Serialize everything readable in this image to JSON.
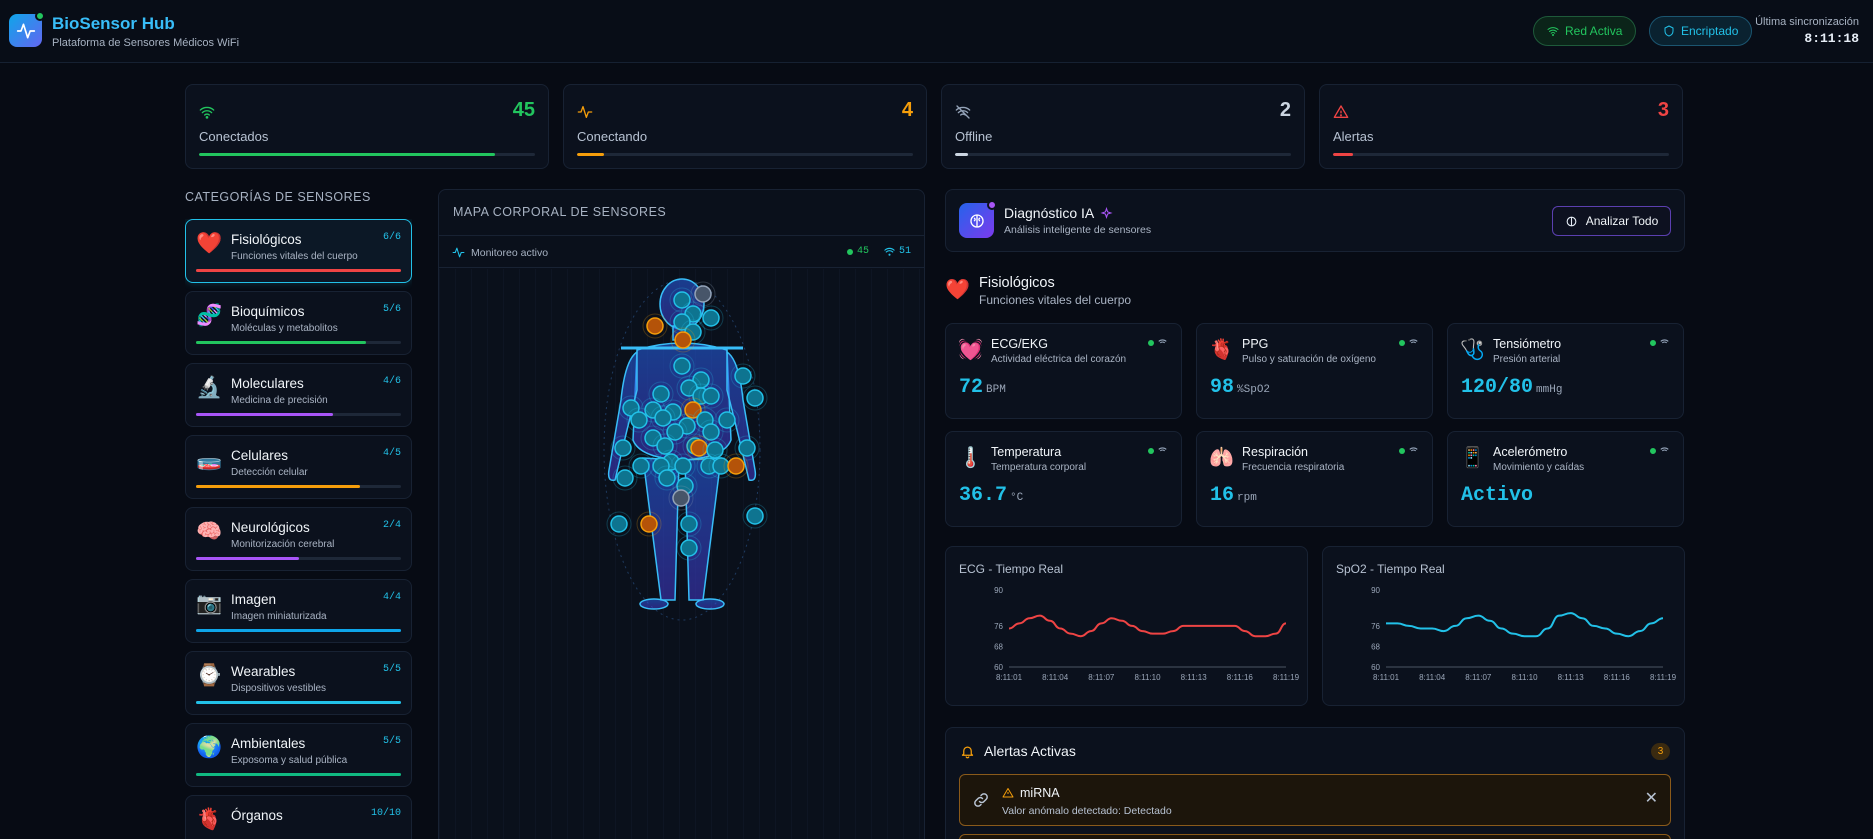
{
  "header": {
    "title": "BioSensor Hub",
    "subtitle": "Plataforma de Sensores Médicos WiFi",
    "network_label": "Red Activa",
    "encrypted_label": "Encriptado",
    "sync_label": "Última sincronización",
    "sync_time": "8:11:18"
  },
  "stats": [
    {
      "label": "Conectados",
      "value": "45",
      "color": "#22c55e",
      "progress": 0.88
    },
    {
      "label": "Conectando",
      "value": "4",
      "color": "#f59e0b",
      "progress": 0.08
    },
    {
      "label": "Offline",
      "value": "2",
      "color": "#cbd5e1",
      "progress": 0.04
    },
    {
      "label": "Alertas",
      "value": "3",
      "color": "#ef4444",
      "progress": 0.06
    }
  ],
  "categories": {
    "heading": "CATEGORÍAS DE SENSORES",
    "items": [
      {
        "emoji": "❤️",
        "name": "Fisiológicos",
        "desc": "Funciones vitales del cuerpo",
        "count": "6/6",
        "color": "#ef4444",
        "progress": 1.0
      },
      {
        "emoji": "🧬",
        "name": "Bioquímicos",
        "desc": "Moléculas y metabolitos",
        "count": "5/6",
        "color": "#22c55e",
        "progress": 0.83
      },
      {
        "emoji": "🔬",
        "name": "Moleculares",
        "desc": "Medicina de precisión",
        "count": "4/6",
        "color": "#a855f7",
        "progress": 0.67
      },
      {
        "emoji": "🧫",
        "name": "Celulares",
        "desc": "Detección celular",
        "count": "4/5",
        "color": "#f59e0b",
        "progress": 0.8
      },
      {
        "emoji": "🧠",
        "name": "Neurológicos",
        "desc": "Monitorización cerebral",
        "count": "2/4",
        "color": "#a855f7",
        "progress": 0.5
      },
      {
        "emoji": "📷",
        "name": "Imagen",
        "desc": "Imagen miniaturizada",
        "count": "4/4",
        "color": "#0ea5e9",
        "progress": 1.0
      },
      {
        "emoji": "⌚",
        "name": "Wearables",
        "desc": "Dispositivos vestibles",
        "count": "5/5",
        "color": "#22c1e8",
        "progress": 1.0
      },
      {
        "emoji": "🌍",
        "name": "Ambientales",
        "desc": "Exposoma y salud pública",
        "count": "5/5",
        "color": "#10b981",
        "progress": 1.0
      },
      {
        "emoji": "🫀",
        "name": "Órganos",
        "desc": "",
        "count": "10/10",
        "color": "#22c1e8",
        "progress": 1.0
      }
    ]
  },
  "map": {
    "title": "MAPA CORPORAL DE SENSORES",
    "status": "Monitoreo activo",
    "active_count": "45",
    "wifi_count": "51"
  },
  "ai": {
    "title": "Diagnóstico IA",
    "subtitle": "Análisis inteligente de sensores",
    "button": "Analizar Todo"
  },
  "section": {
    "emoji": "❤️",
    "title": "Fisiológicos",
    "subtitle": "Funciones vitales del cuerpo"
  },
  "sensors": [
    {
      "emoji": "💓",
      "name": "ECG/EKG",
      "desc": "Actividad eléctrica del corazón",
      "value": "72",
      "unit": "BPM"
    },
    {
      "emoji": "🫀",
      "name": "PPG",
      "desc": "Pulso y saturación de oxígeno",
      "value": "98",
      "unit": "%SpO2"
    },
    {
      "emoji": "🩺",
      "name": "Tensiómetro",
      "desc": "Presión arterial",
      "value": "120/80",
      "unit": "mmHg"
    },
    {
      "emoji": "🌡️",
      "name": "Temperatura",
      "desc": "Temperatura corporal",
      "value": "36.7",
      "unit": "°C"
    },
    {
      "emoji": "🫁",
      "name": "Respiración",
      "desc": "Frecuencia respiratoria",
      "value": "16",
      "unit": "rpm"
    },
    {
      "emoji": "📱",
      "name": "Acelerómetro",
      "desc": "Movimiento y caídas",
      "value": "Activo",
      "unit": ""
    }
  ],
  "chart_data": [
    {
      "type": "line",
      "title": "ECG - Tiempo Real",
      "color": "#ef4444",
      "yticks": [
        60,
        68,
        76,
        90
      ],
      "ylim": [
        60,
        90
      ],
      "xticks": [
        "8:11:01",
        "8:11:04",
        "8:11:07",
        "8:11:10",
        "8:11:13",
        "8:11:16",
        "8:11:19"
      ],
      "values": [
        75,
        77,
        79,
        80,
        78,
        75,
        73,
        72,
        74,
        77,
        79,
        78,
        76,
        74,
        73,
        73,
        74,
        76,
        76,
        76,
        76,
        76,
        76,
        74,
        72,
        72,
        73,
        77
      ]
    },
    {
      "type": "line",
      "title": "SpO2 - Tiempo Real",
      "color": "#22c1e8",
      "yticks": [
        60,
        68,
        76,
        90
      ],
      "ylim": [
        60,
        90
      ],
      "xticks": [
        "8:11:01",
        "8:11:04",
        "8:11:07",
        "8:11:10",
        "8:11:13",
        "8:11:16",
        "8:11:19"
      ],
      "values": [
        77,
        77,
        76,
        75,
        75,
        74,
        76,
        79,
        80,
        78,
        75,
        73,
        72,
        72,
        75,
        80,
        81,
        79,
        76,
        75,
        73,
        72,
        74,
        77,
        79
      ]
    }
  ],
  "alerts": {
    "title": "Alertas Activas",
    "count": "3",
    "items": [
      {
        "name": "miRNA",
        "desc": "Valor anómalo detectado: Detectado"
      }
    ]
  }
}
